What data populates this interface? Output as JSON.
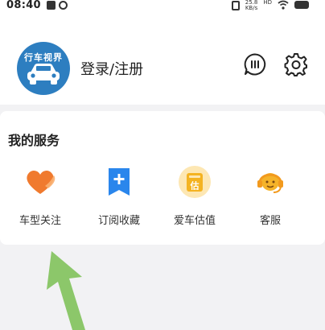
{
  "status_bar": {
    "time": "08:40",
    "net_speed_value": "25.8",
    "net_speed_unit": "KB/s",
    "network_label": "HD"
  },
  "header": {
    "avatar_text": "行车视界",
    "login_label": "登录/注册"
  },
  "services": {
    "title": "我的服务",
    "items": [
      {
        "label": "车型关注",
        "icon": "heart-icon",
        "color": "#f07a2e"
      },
      {
        "label": "订阅收藏",
        "icon": "bookmark-plus-icon",
        "color": "#2a86ec"
      },
      {
        "label": "爱车估值",
        "icon": "valuation-icon",
        "icon_text": "估",
        "color": "#f4b321"
      },
      {
        "label": "客服",
        "icon": "customer-service-icon",
        "color": "#f5b32a"
      }
    ]
  },
  "colors": {
    "avatar_bg": "#2d7ec0",
    "arrow": "#8cc76a",
    "page_bg": "#f2f2f4"
  }
}
